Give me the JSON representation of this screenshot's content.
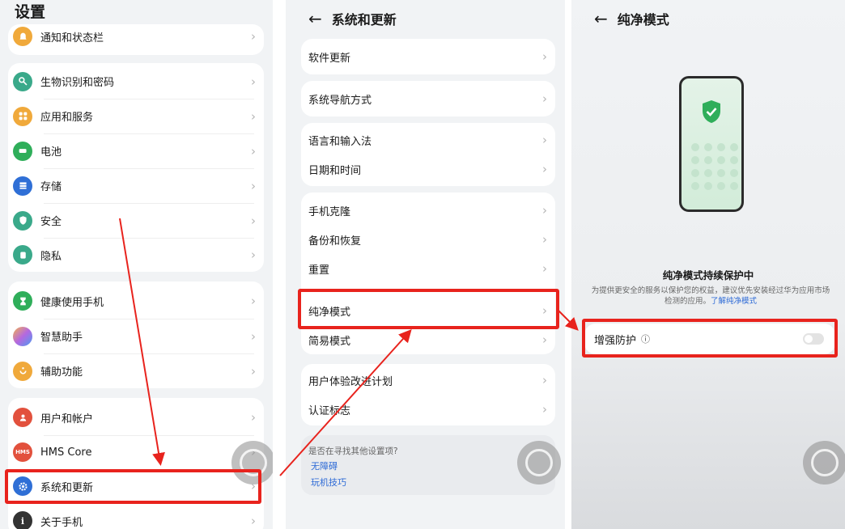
{
  "settings": {
    "title": "设置",
    "items": [
      {
        "label": "通知和状态栏",
        "icon": "bell-icon",
        "color": "#f0a93b"
      },
      {
        "label": "生物识别和密码",
        "icon": "key-icon",
        "color": "#3aa98a"
      },
      {
        "label": "应用和服务",
        "icon": "apps-icon",
        "color": "#f0a93b"
      },
      {
        "label": "电池",
        "icon": "battery-icon",
        "color": "#2fae5a"
      },
      {
        "label": "存储",
        "icon": "storage-icon",
        "color": "#2f6fd6"
      },
      {
        "label": "安全",
        "icon": "shield-icon",
        "color": "#3aa98a"
      },
      {
        "label": "隐私",
        "icon": "privacy-icon",
        "color": "#3aa98a"
      },
      {
        "label": "健康使用手机",
        "icon": "hourglass-icon",
        "color": "#2fae5a"
      },
      {
        "label": "智慧助手",
        "icon": "assistant-icon",
        "color": "#b468e0"
      },
      {
        "label": "辅助功能",
        "icon": "accessibility-icon",
        "color": "#f0a93b"
      },
      {
        "label": "用户和帐户",
        "icon": "user-icon",
        "color": "#e2513d"
      },
      {
        "label": "HMS Core",
        "icon": "hms-icon",
        "color": "#e2513d",
        "badge": "HMS"
      },
      {
        "label": "系统和更新",
        "icon": "gear-icon",
        "color": "#2f6fd6"
      },
      {
        "label": "关于手机",
        "icon": "info-icon",
        "color": "#333333"
      }
    ]
  },
  "system": {
    "title": "系统和更新",
    "items": [
      "软件更新",
      "系统导航方式",
      "语言和输入法",
      "日期和时间",
      "手机克隆",
      "备份和恢复",
      "重置",
      "纯净模式",
      "简易模式",
      "用户体验改进计划",
      "认证标志"
    ],
    "help_question": "是否在寻找其他设置项?",
    "help_links": [
      "无障碍",
      "玩机技巧"
    ]
  },
  "pure_mode": {
    "title": "纯净模式",
    "status_title": "纯净模式持续保护中",
    "description": "为提供更安全的服务以保护您的权益，建议优先安装经过华为应用市场检测的应用。",
    "learn_more": "了解纯净模式",
    "enhanced_label": "增强防护",
    "enhanced_enabled": false
  },
  "colors": {
    "highlight": "#e8231d",
    "link": "#2d6ad6"
  }
}
